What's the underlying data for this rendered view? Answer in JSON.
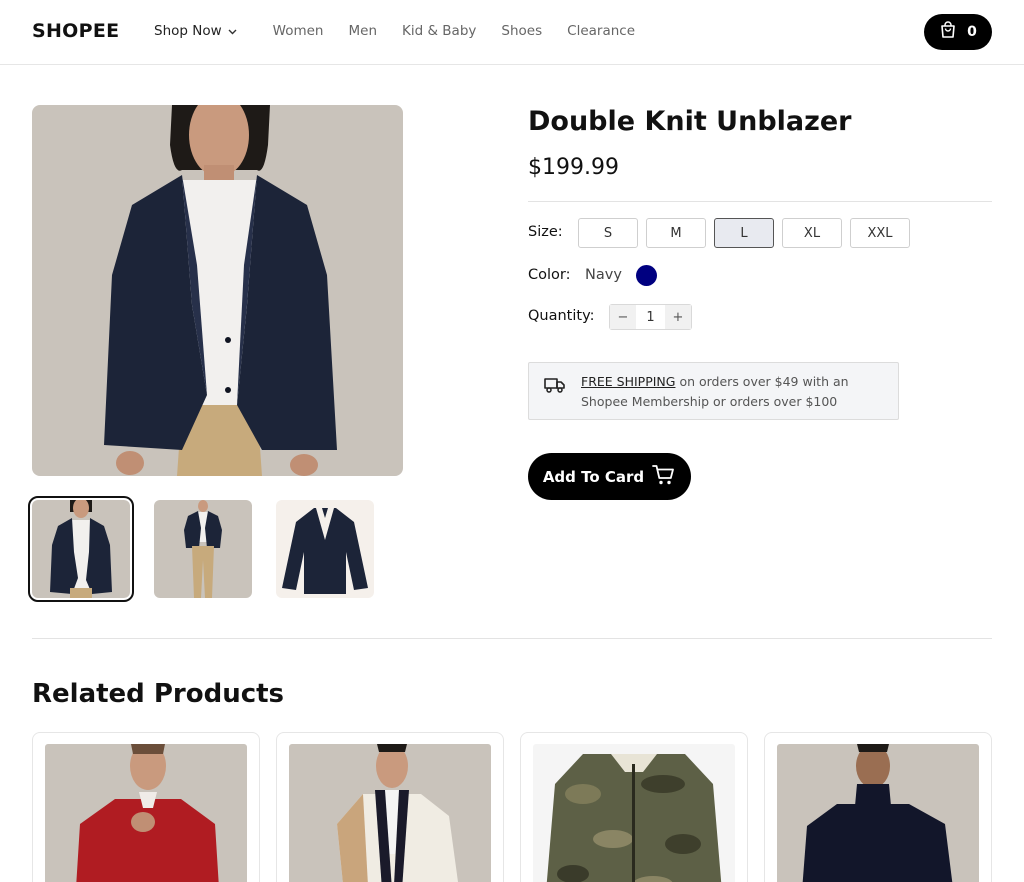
{
  "header": {
    "logo": "SHOPEE",
    "nav": {
      "shop_now": "Shop Now",
      "items": [
        "Women",
        "Men",
        "Kid & Baby",
        "Shoes",
        "Clearance"
      ]
    },
    "cart_count": "0",
    "cart_icon": "shopping-bag-icon"
  },
  "product": {
    "title": "Double Knit Unblazer",
    "price": "$199.99",
    "size_label": "Size:",
    "sizes": [
      "S",
      "M",
      "L",
      "XL",
      "XXL"
    ],
    "selected_size": "L",
    "color_label": "Color:",
    "color_name": "Navy",
    "color_hex": "#000080",
    "quantity_label": "Quantity:",
    "quantity": "1",
    "qty_minus": "−",
    "qty_plus": "+",
    "shipping": {
      "link": "FREE SHIPPING",
      "text": " on orders over $49 with an Shopee Membership or orders over $100",
      "icon": "truck-icon"
    },
    "add_button": "Add To Card",
    "add_icon": "cart-icon"
  },
  "related": {
    "title": "Related Products",
    "items": [
      {
        "name": "red-fleece-quarter-zip"
      },
      {
        "name": "colorblock-cardigan"
      },
      {
        "name": "camo-puffer-jacket"
      },
      {
        "name": "navy-turtleneck"
      }
    ]
  },
  "colors": {
    "accent": "#000000",
    "navy_swatch": "#000080",
    "shipping_bg": "#f4f5f7"
  }
}
